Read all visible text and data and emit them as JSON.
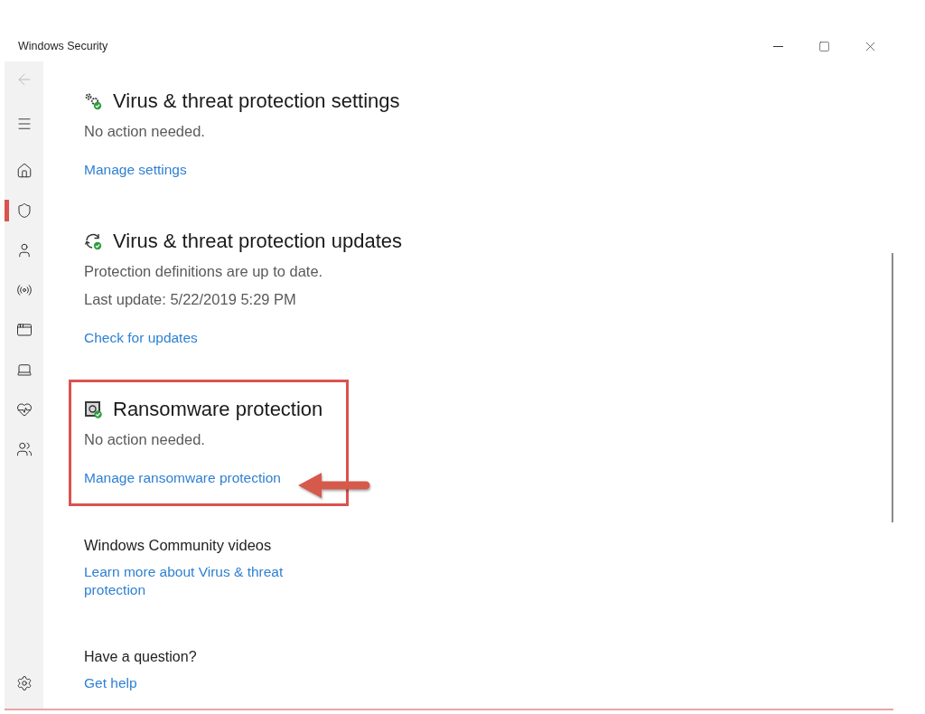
{
  "window": {
    "title": "Windows Security"
  },
  "sidebar": {
    "back": {
      "disabled": true
    },
    "items": [
      {
        "kind": "home",
        "selected": false
      },
      {
        "kind": "shield",
        "selected": true
      },
      {
        "kind": "account",
        "selected": false
      },
      {
        "kind": "network",
        "selected": false
      },
      {
        "kind": "app",
        "selected": false
      },
      {
        "kind": "device",
        "selected": false
      },
      {
        "kind": "health",
        "selected": false
      },
      {
        "kind": "family",
        "selected": false
      }
    ],
    "footer": [
      {
        "kind": "settings",
        "selected": false
      }
    ]
  },
  "sections": [
    {
      "kind": "settings",
      "title": "Virus & threat protection settings",
      "lines": [
        "No action needed."
      ],
      "link": "Manage settings",
      "highlighted": false
    },
    {
      "kind": "updates",
      "title": "Virus & threat protection updates",
      "lines": [
        "Protection definitions are up to date.",
        "Last update: 5/22/2019 5:29 PM"
      ],
      "link": "Check for updates",
      "highlighted": false
    },
    {
      "kind": "ransomware",
      "title": "Ransomware protection",
      "lines": [
        "No action needed."
      ],
      "link": "Manage ransomware protection",
      "highlighted": true
    }
  ],
  "community": {
    "title": "Windows Community videos",
    "link": "Learn more about Virus & threat protection"
  },
  "help": {
    "title": "Have a question?",
    "link": "Get help"
  }
}
